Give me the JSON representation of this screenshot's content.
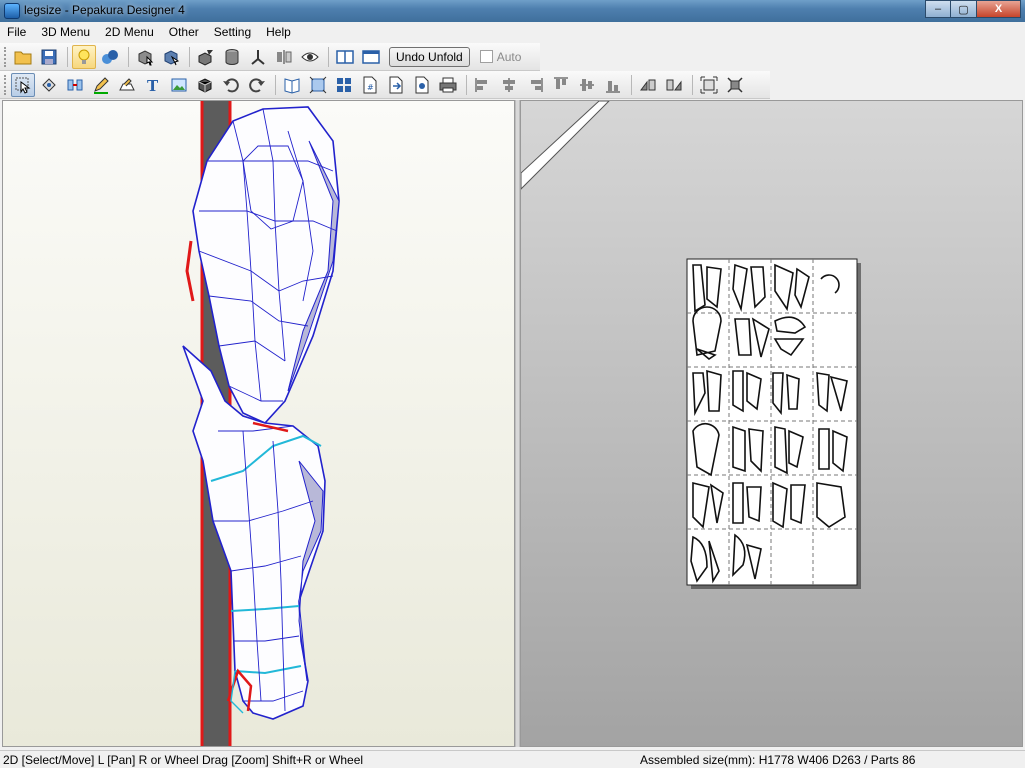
{
  "window": {
    "title": "legsize - Pepakura Designer 4",
    "buttons": {
      "minimize": "–",
      "maximize": "▢",
      "close": "X"
    }
  },
  "menu": [
    "File",
    "3D Menu",
    "2D Menu",
    "Other",
    "Setting",
    "Help"
  ],
  "toolbar1": {
    "undo_unfold_label": "Undo Unfold",
    "auto_label": "Auto",
    "auto_checked": false
  },
  "status": {
    "left": "2D [Select/Move] L [Pan] R or Wheel Drag [Zoom] Shift+R or Wheel",
    "right": "Assembled size(mm): H1778 W406 D263 / Parts 86"
  }
}
